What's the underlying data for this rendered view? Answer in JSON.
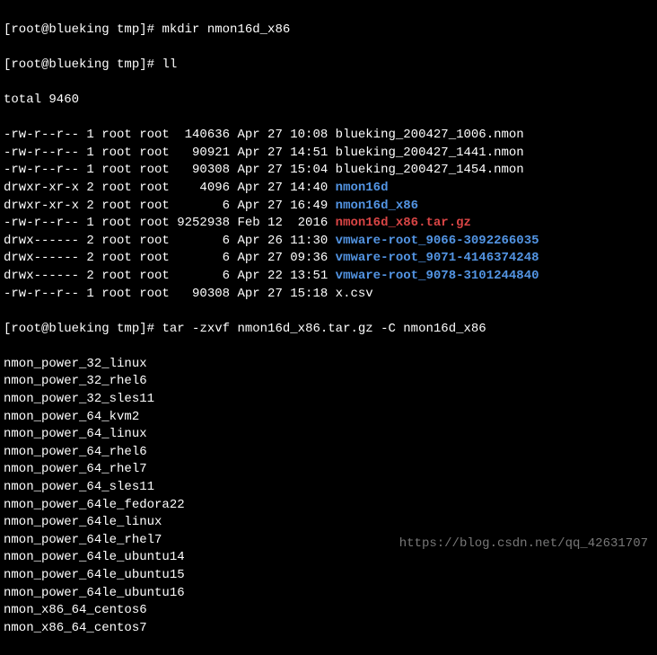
{
  "prompt1": "[root@blueking tmp]# ",
  "cmd1": "mkdir nmon16d_x86",
  "prompt2": "[root@blueking tmp]# ",
  "cmd2": "ll",
  "total": "total 9460",
  "files": [
    {
      "perm": "-rw-r--r-- 1 root root  140636 Apr 27 10:08 ",
      "name": "blueking_200427_1006.nmon",
      "type": "normal"
    },
    {
      "perm": "-rw-r--r-- 1 root root   90921 Apr 27 14:51 ",
      "name": "blueking_200427_1441.nmon",
      "type": "normal"
    },
    {
      "perm": "-rw-r--r-- 1 root root   90308 Apr 27 15:04 ",
      "name": "blueking_200427_1454.nmon",
      "type": "normal"
    },
    {
      "perm": "drwxr-xr-x 2 root root    4096 Apr 27 14:40 ",
      "name": "nmon16d",
      "type": "dir"
    },
    {
      "perm": "drwxr-xr-x 2 root root       6 Apr 27 16:49 ",
      "name": "nmon16d_x86",
      "type": "dir"
    },
    {
      "perm": "-rw-r--r-- 1 root root 9252938 Feb 12  2016 ",
      "name": "nmon16d_x86.tar.gz",
      "type": "archive"
    },
    {
      "perm": "drwx------ 2 root root       6 Apr 26 11:30 ",
      "name": "vmware-root_9066-3092266035",
      "type": "dir"
    },
    {
      "perm": "drwx------ 2 root root       6 Apr 27 09:36 ",
      "name": "vmware-root_9071-4146374248",
      "type": "dir"
    },
    {
      "perm": "drwx------ 2 root root       6 Apr 22 13:51 ",
      "name": "vmware-root_9078-3101244840",
      "type": "dir"
    },
    {
      "perm": "-rw-r--r-- 1 root root   90308 Apr 27 15:18 ",
      "name": "x.csv",
      "type": "normal"
    }
  ],
  "prompt3": "[root@blueking tmp]# ",
  "cmd3": "tar -zxvf nmon16d_x86.tar.gz -C nmon16d_x86",
  "tar_output": [
    "nmon_power_32_linux",
    "nmon_power_32_rhel6",
    "nmon_power_32_sles11",
    "nmon_power_64_kvm2",
    "nmon_power_64_linux",
    "nmon_power_64_rhel6",
    "nmon_power_64_rhel7",
    "nmon_power_64_sles11",
    "nmon_power_64le_fedora22",
    "nmon_power_64le_linux",
    "nmon_power_64le_rhel7",
    "nmon_power_64le_ubuntu14",
    "nmon_power_64le_ubuntu15",
    "nmon_power_64le_ubuntu16",
    "nmon_x86_64_centos6",
    "nmon_x86_64_centos7"
  ],
  "watermark": "https://blog.csdn.net/qq_42631707"
}
